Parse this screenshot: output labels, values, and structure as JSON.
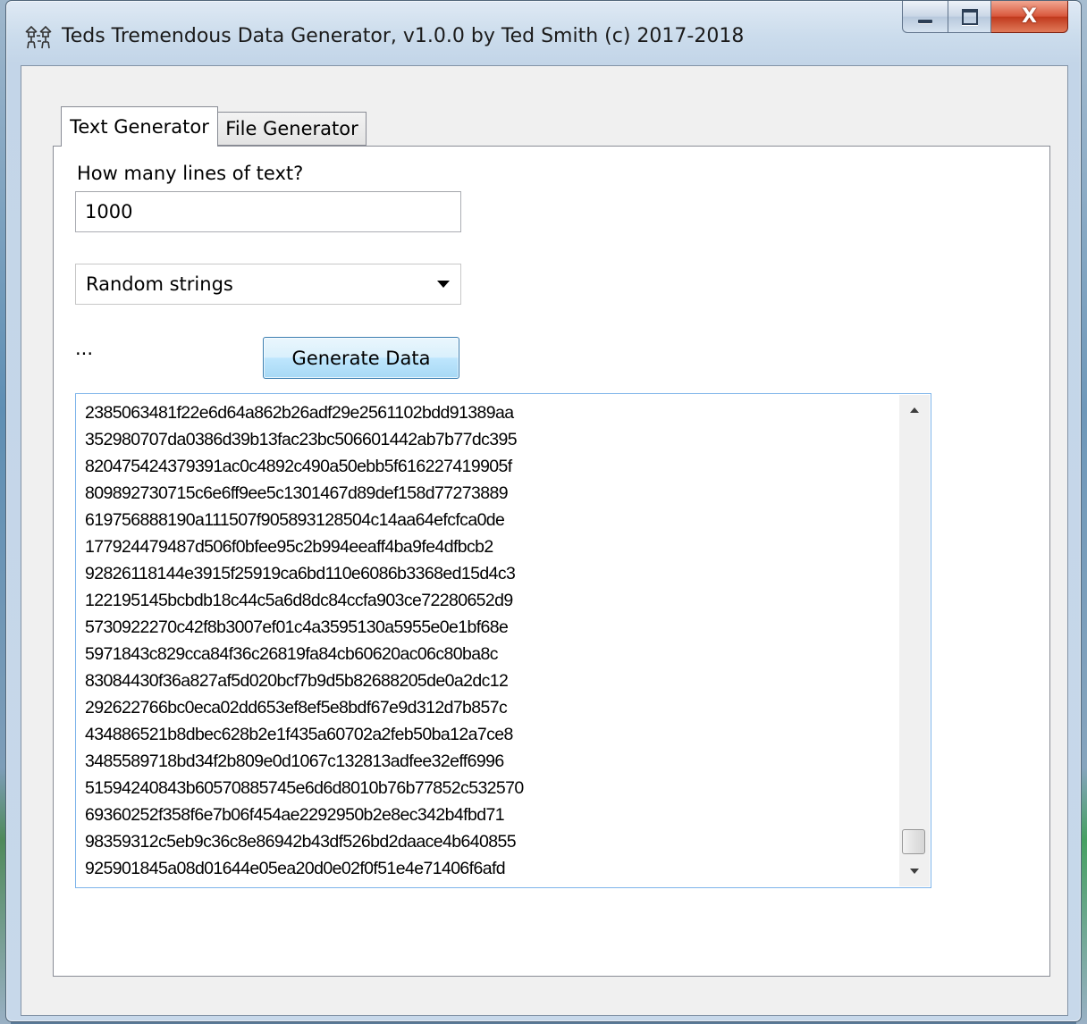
{
  "window": {
    "title": "Teds Tremendous Data Generator, v1.0.0 by Ted Smith (c) 2017-2018",
    "icon": "app-icon",
    "close_glyph": "X"
  },
  "tabs": [
    {
      "label": "Text Generator",
      "active": true
    },
    {
      "label": "File Generator",
      "active": false
    }
  ],
  "text_generator": {
    "lines_label": "How many lines of text?",
    "lines_value": "1000",
    "mode_selected": "Random strings",
    "status": "...",
    "generate_label": "Generate Data",
    "output_lines": [
      "2385063481f22e6d64a862b26adf29e2561102bdd91389aa",
      "352980707da0386d39b13fac23bc506601442ab7b77dc395",
      "820475424379391ac0c4892c490a50ebb5f616227419905f",
      "809892730715c6e6ff9ee5c1301467d89def158d77273889",
      "619756888190a111507f905893128504c14aa64efcfca0de",
      "177924479487d506f0bfee95c2b994eeaff4ba9fe4dfbcb2",
      "92826118144e3915f25919ca6bd110e6086b3368ed15d4c3",
      "122195145bcbdb18c44c5a6d8dc84ccfa903ce72280652d9",
      "5730922270c42f8b3007ef01c4a3595130a5955e0e1bf68e",
      "5971843c829cca84f36c26819fa84cb60620ac06c80ba8c",
      "83084430f36a827af5d020bcf7b9d5b82688205de0a2dc12",
      "292622766bc0eca02dd653ef8ef5e8bdf67e9d312d7b857c",
      "434886521b8dbec628b2e1f435a60702a2feb50ba12a7ce8",
      "3485589718bd34f2b809e0d1067c132813adfee32eff6996",
      "51594240843b60570885745e6d6d8010b76b77852c532570",
      "69360252f358f6e7b06f454ae2292950b2e8ec342b4fbd71",
      "98359312c5eb9c36c8e86942b43df526bd2daace4b640855",
      "925901845a08d01644e05ea20d0e02f0f51e4e71406f6afd"
    ]
  },
  "scrollbar": {
    "position": 0.97
  }
}
